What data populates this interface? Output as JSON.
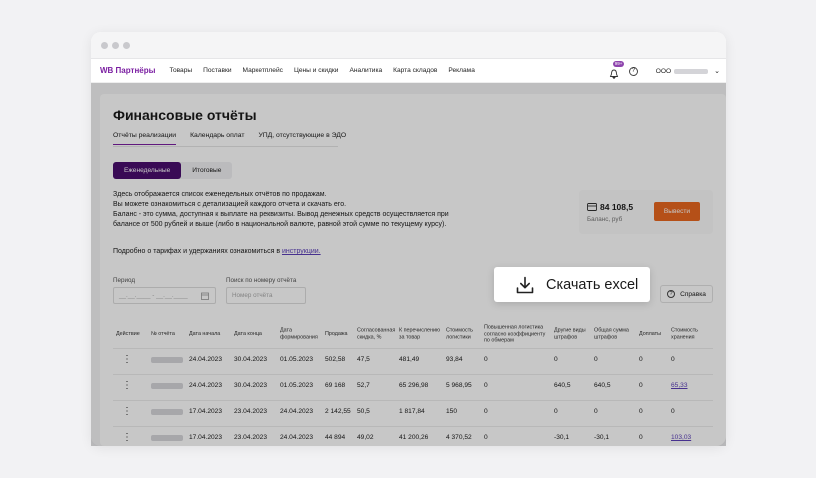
{
  "nav": {
    "logo": "WB Партнёры",
    "items": [
      "Товары",
      "Поставки",
      "Маркетплейс",
      "Цены и скидки",
      "Аналитика",
      "Карта складов",
      "Реклама"
    ],
    "notifications_badge": "99+",
    "org_prefix": "ООО"
  },
  "page": {
    "title": "Финансовые отчёты",
    "tabs": [
      "Отчёты реализации",
      "Календарь оплат",
      "УПД, отсутствующие в ЭДО"
    ],
    "segments": [
      "Еженедельные",
      "Итоговые"
    ],
    "description": [
      "Здесь отображается список еженедельных отчётов по продажам.",
      "Вы можете ознакомиться с детализацией каждого отчета и скачать его.",
      "Баланс - это сумма, доступная к выплате на реквизиты. Вывод денежных средств осуществляется при",
      "балансе от 500 рублей и выше (либо в национальной валюте, равной этой сумме по текущему курсу)."
    ],
    "more_text": "Подробно о тарифах и удержаниях ознакомиться в ",
    "more_link": "инструкции.",
    "balance": {
      "amount": "84 108,5",
      "label": "Баланс, руб",
      "withdraw": "Вывести"
    },
    "filters": {
      "period_label": "Период",
      "period_placeholder": "__.__.____ - __.__.____",
      "search_label": "Поиск по номеру отчёта",
      "search_placeholder": "Номер отчёта"
    },
    "help_label": "Справка",
    "download_label": "Скачать excel"
  },
  "table": {
    "headers": [
      "Действие",
      "№ отчёта",
      "Дата начала",
      "Дата конца",
      "Дата формирования",
      "Продажа",
      "Согласованная скидка, %",
      "К перечислению за товар",
      "Стоимость логистики",
      "Повышенная логистика согласно коэффициенту по обмерам",
      "Другие виды штрафов",
      "Общая сумма штрафов",
      "Доплаты",
      "Стоимость хранения"
    ],
    "rows": [
      [
        "24.04.2023",
        "30.04.2023",
        "01.05.2023",
        "502,58",
        "47,5",
        "481,49",
        "93,84",
        "0",
        "0",
        "0",
        "0",
        "0"
      ],
      [
        "24.04.2023",
        "30.04.2023",
        "01.05.2023",
        "69 168",
        "52,7",
        "65 296,98",
        "5 968,95",
        "0",
        "640,5",
        "640,5",
        "0",
        "65,33"
      ],
      [
        "17.04.2023",
        "23.04.2023",
        "24.04.2023",
        "2 142,55",
        "50,5",
        "1 817,84",
        "150",
        "0",
        "0",
        "0",
        "0",
        "0"
      ],
      [
        "17.04.2023",
        "23.04.2023",
        "24.04.2023",
        "44 894",
        "49,02",
        "41 200,26",
        "4 370,52",
        "0",
        "-30,1",
        "-30,1",
        "0",
        "103,03"
      ]
    ]
  }
}
